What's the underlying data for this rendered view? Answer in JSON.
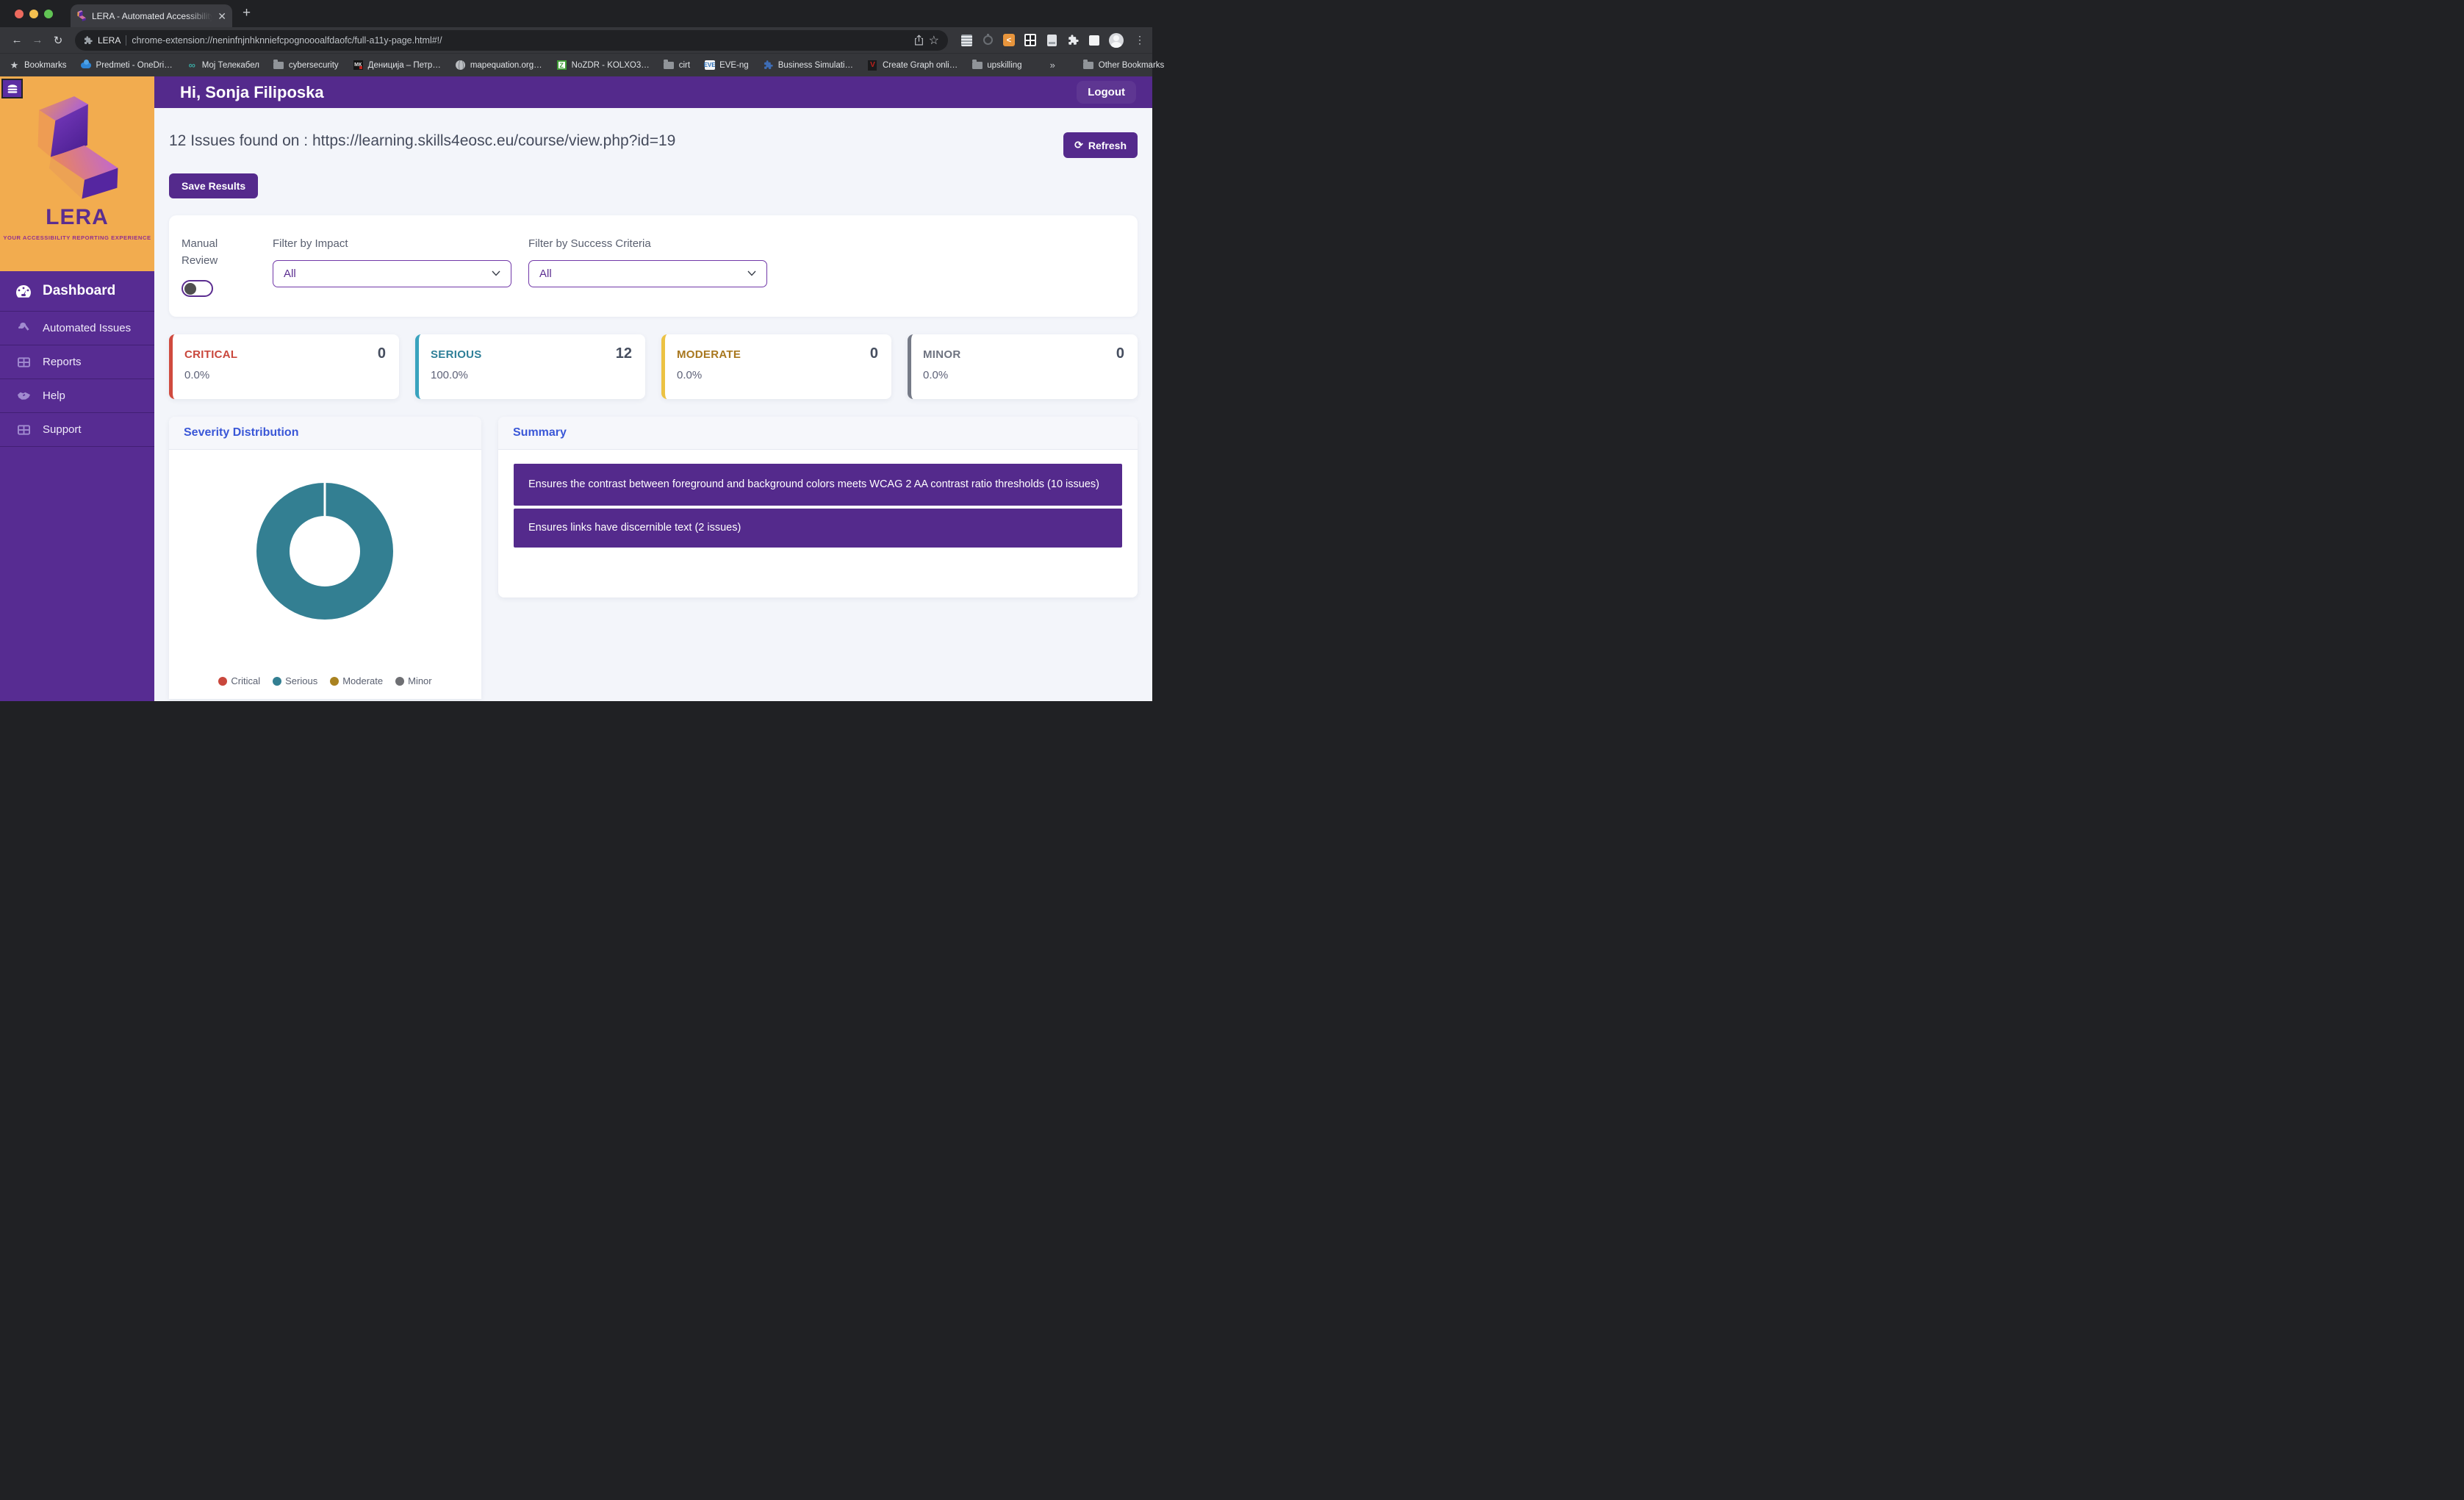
{
  "browser": {
    "tab_title": "LERA - Automated Accessibility",
    "close_glyph": "✕",
    "new_tab_glyph": "+",
    "back_glyph": "←",
    "forward_glyph": "→",
    "reload_glyph": "↻",
    "omnibox": {
      "site_label": "LERA",
      "url": "chrome-extension://neninfnjnhknniefcpognoooalfdaofc/full-a11y-page.html#!/"
    },
    "menu_dots": "⋮",
    "bookmarks": [
      {
        "icon": "star-icon",
        "label": "Bookmarks"
      },
      {
        "icon": "onedrive-icon",
        "label": "Predmeti - OneDri…"
      },
      {
        "icon": "infinity-icon",
        "label": "Мој Телекабел"
      },
      {
        "icon": "folder-icon",
        "label": "cybersecurity"
      },
      {
        "icon": "mk-site-icon",
        "label": "Дениција – Петр…"
      },
      {
        "icon": "globe-icon",
        "label": "mapequation.org…"
      },
      {
        "icon": "z-site-icon",
        "label": "NoZDR - KOLXO3…"
      },
      {
        "icon": "folder-icon",
        "label": "cirt"
      },
      {
        "icon": "eve-icon",
        "label": "EVE-ng"
      },
      {
        "icon": "puzzle-blue-icon",
        "label": "Business Simulati…"
      },
      {
        "icon": "v-site-icon",
        "label": "Create Graph onli…"
      },
      {
        "icon": "folder-icon",
        "label": "upskilling"
      }
    ],
    "overflow_chevron": "»",
    "other_bookmarks": "Other Bookmarks"
  },
  "sidebar": {
    "logo_word": "LERA",
    "tagline": "YOUR ACCESSIBILITY REPORTING EXPERIENCE",
    "items": [
      {
        "label": "Dashboard",
        "icon": "gauge-icon",
        "active": true
      },
      {
        "label": "Automated Issues",
        "icon": "wrench-icon",
        "active": false
      },
      {
        "label": "Reports",
        "icon": "table-icon",
        "active": false
      },
      {
        "label": "Help",
        "icon": "handshake-icon",
        "active": false
      },
      {
        "label": "Support",
        "icon": "table-icon",
        "active": false
      }
    ]
  },
  "header": {
    "greeting": "Hi, Sonja Filiposka",
    "logout_label": "Logout"
  },
  "main": {
    "page_title": "12 Issues found on : https://learning.skills4eosc.eu/course/view.php?id=19",
    "refresh_label": "Refresh",
    "refresh_glyph": "⟳",
    "save_label": "Save Results",
    "filters": {
      "manual_review_label": "Manual Review",
      "impact_label": "Filter by Impact",
      "impact_value": "All",
      "criteria_label": "Filter by Success Criteria",
      "criteria_value": "All"
    },
    "stats": [
      {
        "label": "CRITICAL",
        "count": "0",
        "percent": "0.0%",
        "text_color": "#C9473C",
        "border_color": "#D04A3E"
      },
      {
        "label": "SERIOUS",
        "count": "12",
        "percent": "100.0%",
        "text_color": "#2E7F98",
        "border_color": "#39A3BE"
      },
      {
        "label": "MODERATE",
        "count": "0",
        "percent": "0.0%",
        "text_color": "#A8771E",
        "border_color": "#ECC243"
      },
      {
        "label": "MINOR",
        "count": "0",
        "percent": "0.0%",
        "text_color": "#6E7380",
        "border_color": "#757A87"
      }
    ],
    "severity_panel_title": "Severity Distribution",
    "summary_panel_title": "Summary",
    "summary_items": [
      "Ensures the contrast between foreground and background colors meets WCAG 2 AA contrast ratio thresholds (10 issues)",
      "Ensures links have discernible text (2 issues)"
    ],
    "summary_bar_color": "#542A8C"
  },
  "chart_data": {
    "type": "pie",
    "donut": true,
    "title": "Severity Distribution",
    "categories": [
      "Critical",
      "Serious",
      "Moderate",
      "Minor"
    ],
    "values": [
      0,
      12,
      0,
      0
    ],
    "colors": [
      "#C9473C",
      "#337F92",
      "#A98220",
      "#6E6F73"
    ],
    "legend_position": "bottom"
  }
}
